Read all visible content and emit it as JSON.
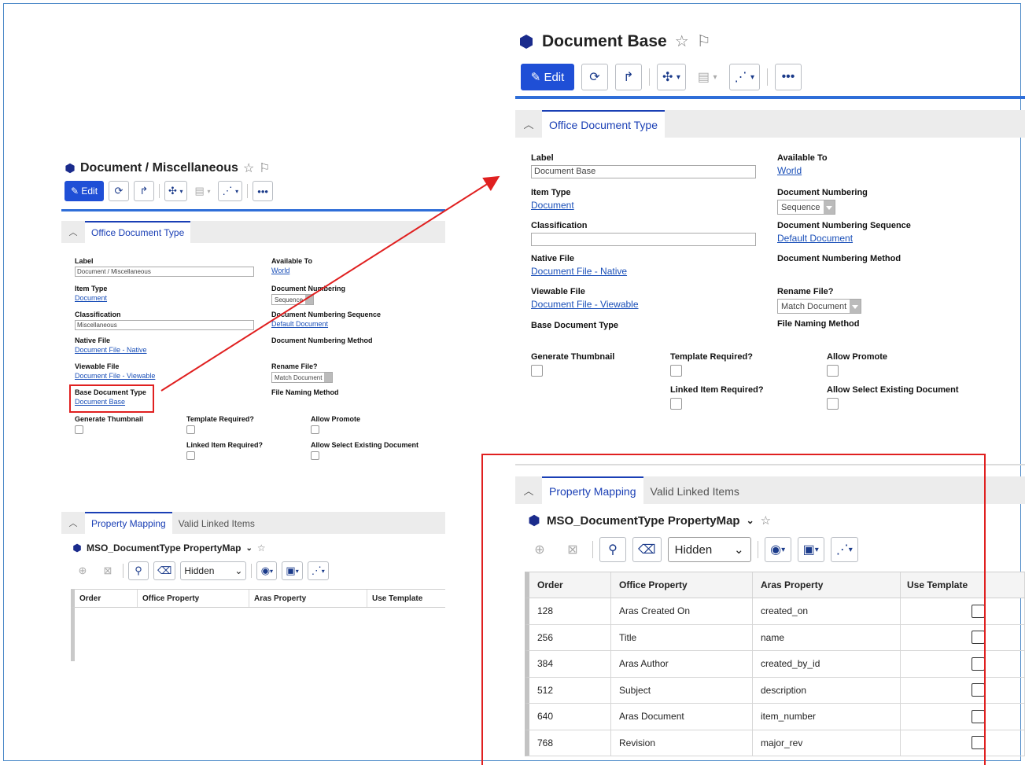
{
  "colors": {
    "accent": "#1f4fd6",
    "link": "#1a4fb8",
    "highlight_red": "#e02020",
    "frame": "#4a88c7"
  },
  "left": {
    "title": "Document / Miscellaneous",
    "toolbar": {
      "edit_label": "Edit",
      "more_label": "•••"
    },
    "tab": "Office Document Type",
    "fields": {
      "label": {
        "label": "Label",
        "value": "Document / Miscellaneous"
      },
      "available_to": {
        "label": "Available To",
        "value": "World"
      },
      "item_type": {
        "label": "Item Type",
        "value": "Document"
      },
      "doc_numbering": {
        "label": "Document Numbering",
        "value": "Sequence"
      },
      "classification": {
        "label": "Classification",
        "value": "Miscellaneous"
      },
      "doc_numbering_sequence": {
        "label": "Document Numbering Sequence",
        "value": "Default Document"
      },
      "native_file": {
        "label": "Native File",
        "value": "Document File - Native"
      },
      "doc_numbering_method": {
        "label": "Document Numbering Method"
      },
      "viewable_file": {
        "label": "Viewable File",
        "value": "Document File - Viewable"
      },
      "rename_file": {
        "label": "Rename File?",
        "value": "Match Document"
      },
      "base_doc_type": {
        "label": "Base Document Type",
        "value": "Document Base"
      },
      "file_naming_method": {
        "label": "File Naming Method"
      },
      "generate_thumbnail": {
        "label": "Generate Thumbnail"
      },
      "template_required": {
        "label": "Template Required?"
      },
      "allow_promote": {
        "label": "Allow Promote"
      },
      "linked_item_required": {
        "label": "Linked Item Required?"
      },
      "allow_select_existing": {
        "label": "Allow Select Existing Document"
      }
    },
    "tabs2": [
      "Property Mapping",
      "Valid Linked Items"
    ],
    "sub_title": "MSO_DocumentType PropertyMap",
    "hidden_select": "Hidden",
    "columns": [
      "Order",
      "Office Property",
      "Aras Property",
      "Use Template"
    ]
  },
  "right": {
    "title": "Document Base",
    "toolbar": {
      "edit_label": "Edit",
      "more_label": "•••"
    },
    "tab": "Office Document Type",
    "fields": {
      "label": {
        "label": "Label",
        "value": "Document Base"
      },
      "available_to": {
        "label": "Available To",
        "value": "World"
      },
      "item_type": {
        "label": "Item Type",
        "value": "Document"
      },
      "doc_numbering": {
        "label": "Document Numbering",
        "value": "Sequence"
      },
      "classification": {
        "label": "Classification",
        "value": ""
      },
      "doc_numbering_sequence": {
        "label": "Document Numbering Sequence",
        "value": "Default Document"
      },
      "native_file": {
        "label": "Native File",
        "value": "Document File - Native"
      },
      "doc_numbering_method": {
        "label": "Document Numbering Method"
      },
      "viewable_file": {
        "label": "Viewable File",
        "value": "Document File - Viewable"
      },
      "rename_file": {
        "label": "Rename File?",
        "value": "Match Document"
      },
      "base_doc_type": {
        "label": "Base Document Type"
      },
      "file_naming_method": {
        "label": "File Naming Method"
      },
      "generate_thumbnail": {
        "label": "Generate Thumbnail"
      },
      "template_required": {
        "label": "Template Required?"
      },
      "allow_promote": {
        "label": "Allow Promote"
      },
      "linked_item_required": {
        "label": "Linked Item Required?"
      },
      "allow_select_existing": {
        "label": "Allow Select Existing Document"
      }
    },
    "tabs2": [
      "Property Mapping",
      "Valid Linked Items"
    ],
    "sub_title": "MSO_DocumentType PropertyMap",
    "hidden_select": "Hidden",
    "columns": [
      "Order",
      "Office Property",
      "Aras Property",
      "Use Template"
    ],
    "rows": [
      {
        "order": "128",
        "office": "Aras Created On",
        "aras": "created_on"
      },
      {
        "order": "256",
        "office": "Title",
        "aras": "name"
      },
      {
        "order": "384",
        "office": "Aras Author",
        "aras": "created_by_id"
      },
      {
        "order": "512",
        "office": "Subject",
        "aras": "description"
      },
      {
        "order": "640",
        "office": "Aras Document",
        "aras": "item_number"
      },
      {
        "order": "768",
        "office": "Revision",
        "aras": "major_rev"
      }
    ]
  }
}
